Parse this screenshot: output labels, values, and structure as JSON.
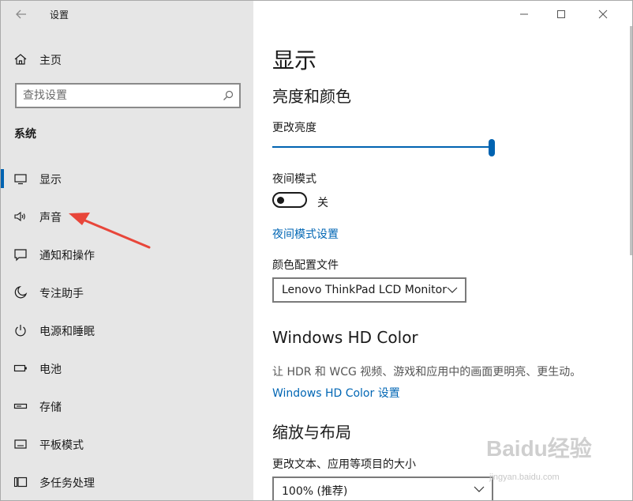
{
  "window": {
    "title": "设置"
  },
  "sidebar": {
    "home_label": "主页",
    "search_placeholder": "查找设置",
    "section_heading": "系统",
    "items": [
      {
        "label": "显示",
        "icon": "monitor-icon",
        "selected": true
      },
      {
        "label": "声音",
        "icon": "speaker-icon",
        "selected": false
      },
      {
        "label": "通知和操作",
        "icon": "message-icon",
        "selected": false
      },
      {
        "label": "专注助手",
        "icon": "moon-icon",
        "selected": false
      },
      {
        "label": "电源和睡眠",
        "icon": "power-icon",
        "selected": false
      },
      {
        "label": "电池",
        "icon": "battery-icon",
        "selected": false
      },
      {
        "label": "存储",
        "icon": "storage-icon",
        "selected": false
      },
      {
        "label": "平板模式",
        "icon": "tablet-icon",
        "selected": false
      },
      {
        "label": "多任务处理",
        "icon": "multitask-icon",
        "selected": false
      }
    ]
  },
  "main": {
    "page_title": "显示",
    "brightness_section": {
      "heading": "亮度和颜色",
      "brightness_label": "更改亮度",
      "brightness_value": 1.0,
      "night_mode_label": "夜间模式",
      "night_mode_state": "关",
      "night_mode_on": false,
      "night_mode_link": "夜间模式设置",
      "color_profile_label": "颜色配置文件",
      "color_profile_value": "Lenovo ThinkPad LCD Monitor"
    },
    "hd_color_section": {
      "heading": "Windows HD Color",
      "description": "让 HDR 和 WCG 视频、游戏和应用中的画面更明亮、更生动。",
      "link": "Windows HD Color 设置"
    },
    "scale_section": {
      "heading": "缩放与布局",
      "scale_label": "更改文本、应用等项目的大小",
      "scale_value": "100% (推荐)"
    }
  },
  "watermark": {
    "logo": "Baidu经验",
    "url": "jingyan.baidu.com"
  },
  "colors": {
    "accent": "#0063b1",
    "link": "#0066b4",
    "sidebar_bg": "#e6e6e6",
    "annotation_arrow": "#e8463a"
  }
}
